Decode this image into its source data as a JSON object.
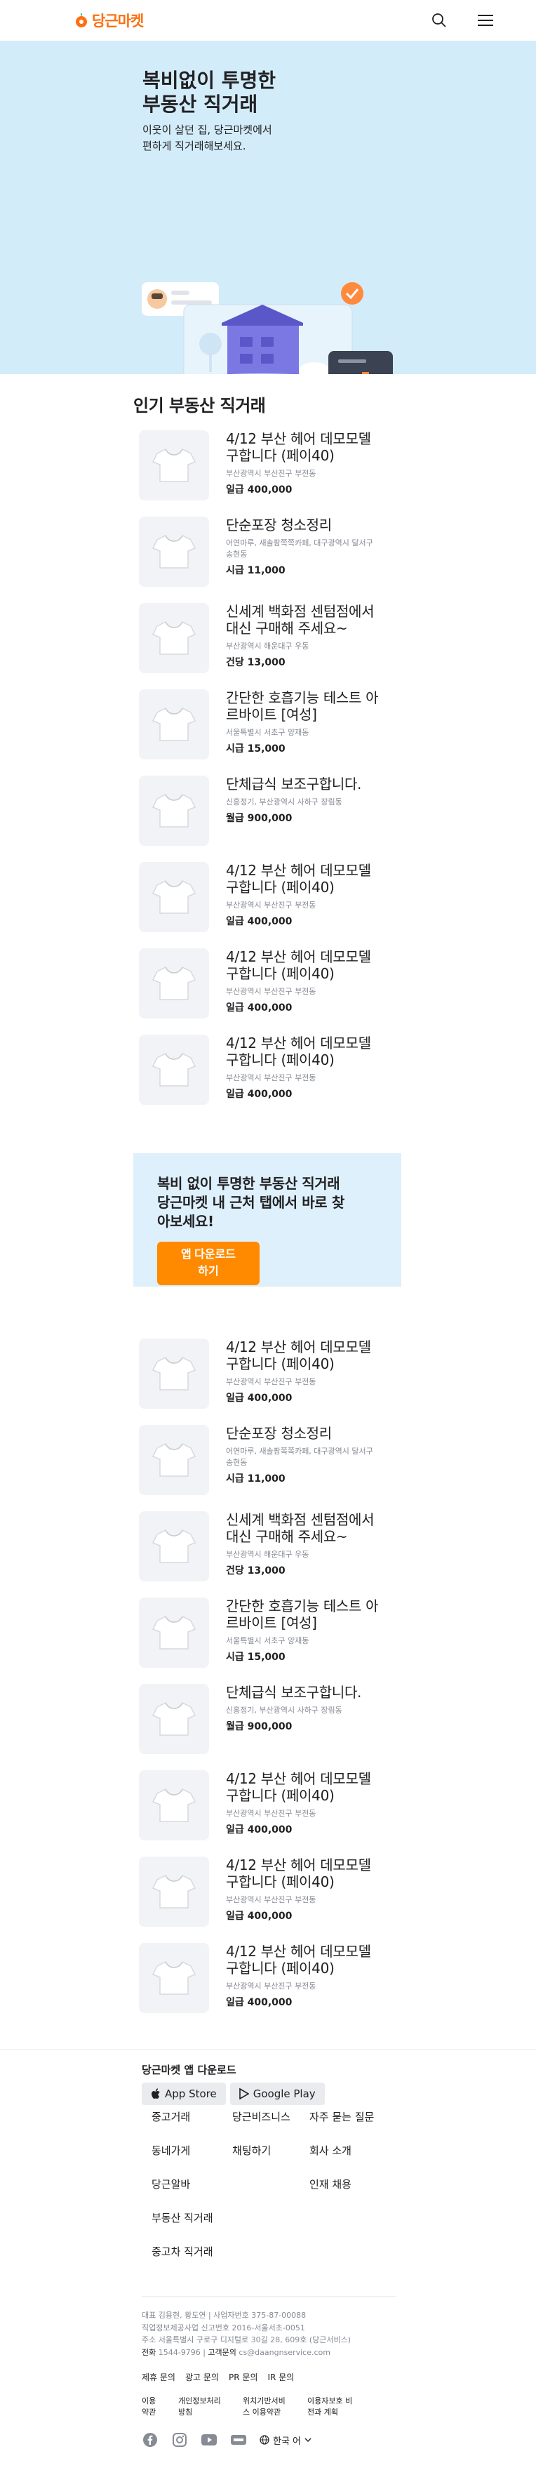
{
  "header": {
    "logo_text": "당근마켓",
    "brand_color": "#ff6f0f",
    "icons": [
      "search-icon",
      "menu-icon"
    ]
  },
  "hero": {
    "title_line1": "복비없이 투명한",
    "title_line2": "부동산 직거래",
    "subtitle_line1": "이웃이 살던 집, 당근마켓에서",
    "subtitle_line2": "편하게 직거래해보세요.",
    "bg_color": "#d3ecf9"
  },
  "section": {
    "title": "인기 부동산 직거래"
  },
  "listings1": [
    {
      "title": "4/12 부산 헤어 데모모델 구합니다 (페이40)",
      "location": "부산광역시 부산진구 부전동",
      "price": "일급 400,000"
    },
    {
      "title": "단순포장 청소정리",
      "location": "어연마루, 새솔팜쪽쪽카페, 대구광역시 달서구 송현동",
      "price": "시급 11,000"
    },
    {
      "title": "신세계 백화점 센텀점에서 대신 구매해 주세요~",
      "location": "부산광역시 해운대구 우동",
      "price": "건당 13,000"
    },
    {
      "title": "간단한 호흡기능 테스트 아르바이트 [여성]",
      "location": "서울특별시 서초구 양재동",
      "price": "시급 15,000"
    },
    {
      "title": "단체급식 보조구합니다.",
      "location": "신흥정기, 부산광역시 사하구 장림동",
      "price": "월급 900,000"
    },
    {
      "title": "4/12 부산 헤어 데모모델 구합니다 (페이40)",
      "location": "부산광역시 부산진구 부전동",
      "price": "일급 400,000"
    },
    {
      "title": "4/12 부산 헤어 데모모델 구합니다 (페이40)",
      "location": "부산광역시 부산진구 부전동",
      "price": "일급 400,000"
    },
    {
      "title": "4/12 부산 헤어 데모모델 구합니다 (페이40)",
      "location": "부산광역시 부산진구 부전동",
      "price": "일급 400,000"
    }
  ],
  "cta": {
    "text_line1": "복비 없이 투명한 부동산 직거래",
    "text_line2": "당근마켓 내 근처 탭에서 바로 찾",
    "text_line3": "아보세요!",
    "button_label": "앱 다운로드 하기",
    "button_color": "#ff8a00"
  },
  "listings2": [
    {
      "title": "4/12 부산 헤어 데모모델 구합니다 (페이40)",
      "location": "부산광역시 부산진구 부전동",
      "price": "일급 400,000"
    },
    {
      "title": "단순포장 청소정리",
      "location": "어연마루, 새솔팜쪽쪽카페, 대구광역시 달서구 송현동",
      "price": "시급 11,000"
    },
    {
      "title": "신세계 백화점 센텀점에서 대신 구매해 주세요~",
      "location": "부산광역시 해운대구 우동",
      "price": "건당 13,000"
    },
    {
      "title": "간단한 호흡기능 테스트 아르바이트 [여성]",
      "location": "서울특별시 서초구 양재동",
      "price": "시급 15,000"
    },
    {
      "title": "단체급식 보조구합니다.",
      "location": "신흥정기, 부산광역시 사하구 장림동",
      "price": "월급 900,000"
    },
    {
      "title": "4/12 부산 헤어 데모모델 구합니다 (페이40)",
      "location": "부산광역시 부산진구 부전동",
      "price": "일급 400,000"
    },
    {
      "title": "4/12 부산 헤어 데모모델 구합니다 (페이40)",
      "location": "부산광역시 부산진구 부전동",
      "price": "일급 400,000"
    },
    {
      "title": "4/12 부산 헤어 데모모델 구합니다 (페이40)",
      "location": "부산광역시 부산진구 부전동",
      "price": "일급 400,000"
    }
  ],
  "footer": {
    "app_download_title": "당근마켓 앱 다운로드",
    "app_store": "App Store",
    "google_play": "Google Play",
    "links": [
      "중고거래",
      "당근비즈니스",
      "자주 묻는 질문",
      "동네가게",
      "채팅하기",
      "회사 소개",
      "당근알바",
      "",
      "인재 채용",
      "부동산 직거래",
      "",
      "",
      "중고차 직거래",
      "",
      ""
    ],
    "corp_line1": "대표 김용현, 황도연 | 사업자번호 375-87-00088",
    "corp_line2": "직업정보제공사업 신고번호 2016-서울서초-0051",
    "corp_line3": "주소 서울특별시 구로구 디지털로 30길 28, 609호 (당근서비스)",
    "corp_phone_label": "전화",
    "corp_phone": "1544-9796",
    "corp_email_label": "고객문의",
    "corp_email": "cs@daangnservice.com",
    "inquiries": [
      "제휴 문의",
      "광고 문의",
      "PR 문의",
      "IR 문의"
    ],
    "policies": [
      "이용약관",
      "개인정보처리방침",
      "위치기반서비스 이용약관",
      "이용자보호 비전과 계획"
    ],
    "language": "한국 어"
  }
}
